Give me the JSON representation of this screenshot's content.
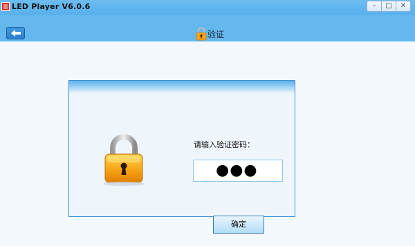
{
  "window": {
    "title": "LED Player V6.0.6",
    "minimize_label": "–",
    "maximize_label": "□",
    "close_label": "✕"
  },
  "header": {
    "back_icon": "arrow-left-icon",
    "lock_icon": "padlock-icon",
    "title": "验证"
  },
  "panel": {
    "lock_icon": "padlock-icon",
    "prompt": "请输入验证密码：",
    "password_display": "●●●"
  },
  "footer": {
    "confirm_label": "确定"
  },
  "colors": {
    "title_bar": "#58b0ec",
    "header_bar": "#64b8ee",
    "panel_border": "#3d8fd0",
    "lock_body": "#f2a21c"
  }
}
